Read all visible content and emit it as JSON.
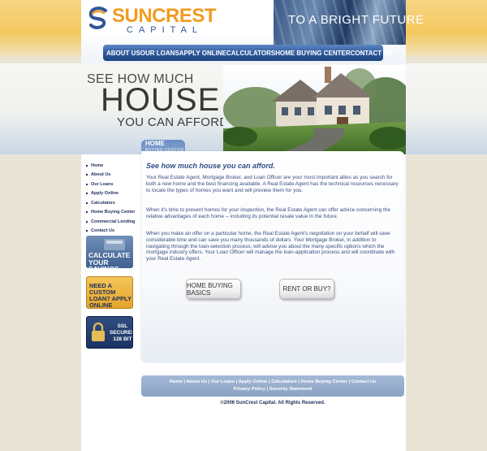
{
  "header": {
    "logo_name": "SUNCREST",
    "logo_sub": "CAPITAL",
    "tagline": "TO A BRIGHT FUTURE"
  },
  "nav": {
    "items": [
      "ABOUT US",
      "OUR LOANS",
      "APPLY ONLINE",
      "CALCULATORS",
      "HOME BUYING CENTER",
      "CONTACT US"
    ]
  },
  "hero": {
    "line1": "SEE HOW MUCH",
    "line2": "HOUSE",
    "line3": "YOU CAN AFFORD."
  },
  "sidebar": {
    "items": [
      "Home",
      "About Us",
      "Our Loans",
      "Apply Online",
      "Calculators",
      "Home Buying Center",
      "Commercial Lending",
      "Contact Us"
    ],
    "promos": {
      "calc": "CALCULATE YOUR SAVINGS",
      "loan": "NEED A CUSTOM LOAN? APPLY ONLINE",
      "ssl_line1": "SSL",
      "ssl_line2": "SECURED",
      "ssl_line3": "128 BIT"
    }
  },
  "content": {
    "tab_title": "HOME",
    "tab_sub": "BUYING CENTER",
    "heading": "See how much house you can afford.",
    "p1": "Your Real Estate Agent, Mortgage Broker, and Loan Officer are your most important allies as you search for both a new home and the best financing available. A Real Estate Agent has the technical resources necessary to locate the types of homes you want and will preview them for you.",
    "p2": "When it's time to present homes for your inspection, the Real Estate Agent can offer advice concerning the relative advantages of each home -- including its potential resale value in the future.",
    "p3": "When you make an offer on a particular home, the Real Estate Agent's negotiation on your behalf will save considerable time and can save you many thousands of dollars. Your Mortgage Broker, in addition to navigating through the loan-selection process, will advise you about the many specific options which the mortgage industry offers. Your Loan Officer will manage the loan-application process and will coordinate with your Real Estate Agent.",
    "btn_basics": "HOME BUYING BASICS",
    "btn_rent": "RENT OR BUY?"
  },
  "footer": {
    "links": [
      "Home",
      "About Us",
      "Our Loans",
      "Apply Online",
      "Calculators",
      "Home Buying Center",
      "Contact Us"
    ],
    "links2": [
      "Privacy Policy",
      "Security Statement"
    ],
    "copyright": "©2006 SunCrest Capital. All Rights Reserved."
  },
  "colors": {
    "accent_gold": "#f29b21",
    "nav_blue": "#2d5799",
    "text_navy": "#1c2f5a"
  }
}
